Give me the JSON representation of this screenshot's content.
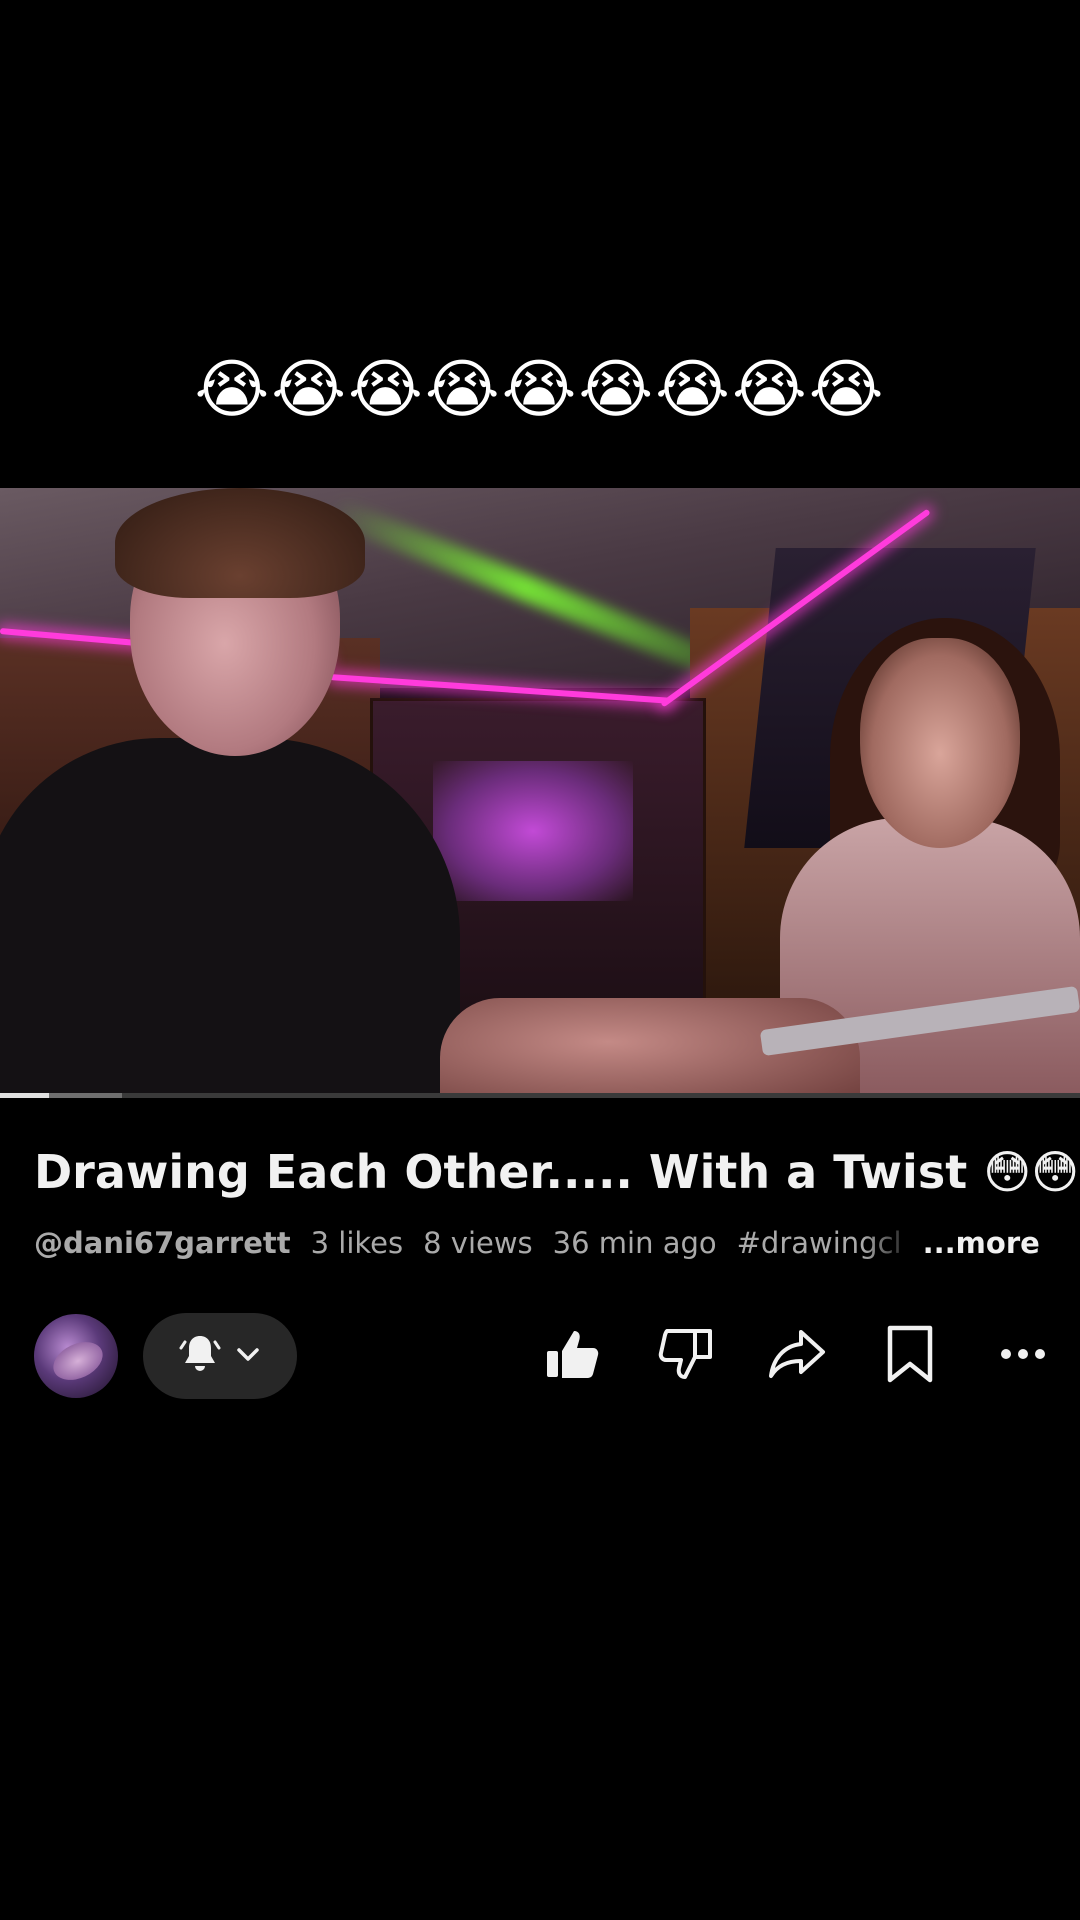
{
  "caption_overlay": {
    "emojis": "😭😭😭😭😭😭😭😭😭"
  },
  "video": {
    "progress_played_fraction": 0.045,
    "progress_buffered_fraction": 0.113
  },
  "info": {
    "title": "Drawing Each Other..... With a Twist 😳😳",
    "channel_handle": "@dani67garrett",
    "likes": "3 likes",
    "views": "8 views",
    "uploaded": "36 min ago",
    "hashtag": "#drawingcl",
    "more_label": "...more"
  },
  "actions": {
    "avatar_icon": "channel-avatar",
    "subscribe_icon": "bell-icon",
    "subscribe_chevron_icon": "chevron-down-icon",
    "like_icon": "thumbs-up-filled-icon",
    "dislike_icon": "thumbs-down-icon",
    "share_icon": "share-arrow-icon",
    "save_icon": "bookmark-icon",
    "more_icon": "more-horizontal-icon"
  },
  "colors": {
    "background": "#000000",
    "title_text": "#f1f1f1",
    "meta_text": "#aaaaaa",
    "pill_bg": "#272727"
  }
}
